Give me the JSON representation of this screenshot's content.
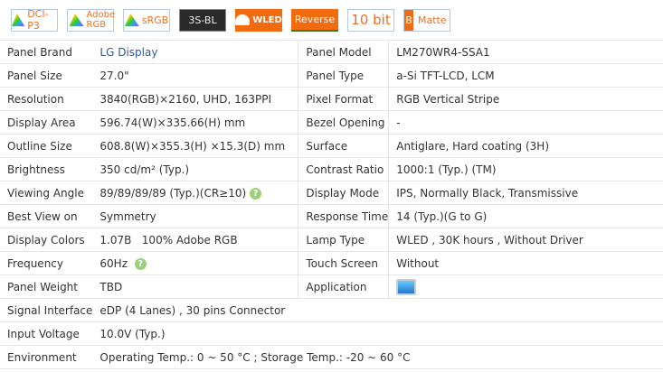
{
  "badges": [
    {
      "label": "DCI-P3",
      "icon": "color-gamut-triangle-icon"
    },
    {
      "label": "Adobe RGB",
      "icon": "color-gamut-triangle-icon"
    },
    {
      "label": "sRGB",
      "icon": "color-gamut-triangle-icon"
    },
    {
      "label": "3S-BL"
    },
    {
      "label": "WLED",
      "icon": "led-icon"
    },
    {
      "label": "Reverse"
    },
    {
      "label": "10 bit"
    },
    {
      "label": "Matte",
      "letter": "B"
    }
  ],
  "specs": {
    "panel_brand": {
      "label": "Panel Brand",
      "value": "LG Display"
    },
    "panel_model": {
      "label": "Panel Model",
      "value": "LM270WR4-SSA1"
    },
    "panel_size": {
      "label": "Panel Size",
      "value": "27.0\""
    },
    "panel_type": {
      "label": "Panel Type",
      "value": "a-Si TFT-LCD, LCM"
    },
    "resolution": {
      "label": "Resolution",
      "value": "3840(RGB)×2160, UHD, 163PPI"
    },
    "pixel_format": {
      "label": "Pixel Format",
      "value": "RGB Vertical Stripe"
    },
    "display_area": {
      "label": "Display Area",
      "value": "596.74(W)×335.66(H) mm"
    },
    "bezel_opening": {
      "label": "Bezel Opening",
      "value": "-"
    },
    "outline_size": {
      "label": "Outline Size",
      "value": "608.8(W)×355.3(H) ×15.3(D) mm"
    },
    "surface": {
      "label": "Surface",
      "value": "Antiglare, Hard coating (3H)"
    },
    "brightness": {
      "label": "Brightness",
      "value": "350 cd/m² (Typ.)"
    },
    "contrast_ratio": {
      "label": "Contrast Ratio",
      "value": "1000:1 (Typ.) (TM)"
    },
    "viewing_angle": {
      "label": "Viewing Angle",
      "value": "89/89/89/89 (Typ.)(CR≥10)"
    },
    "display_mode": {
      "label": "Display Mode",
      "value": "IPS, Normally Black, Transmissive"
    },
    "best_view": {
      "label": "Best View on",
      "value": "Symmetry"
    },
    "response_time": {
      "label": "Response Time",
      "value": "14 (Typ.)(G to G)"
    },
    "display_colors": {
      "label": "Display Colors",
      "value": "1.07B   100% Adobe RGB"
    },
    "lamp_type": {
      "label": "Lamp Type",
      "value": "WLED , 30K hours , Without Driver"
    },
    "frequency": {
      "label": "Frequency",
      "value": "60Hz"
    },
    "touch_screen": {
      "label": "Touch Screen",
      "value": "Without"
    },
    "panel_weight": {
      "label": "Panel Weight",
      "value": "TBD"
    },
    "application": {
      "label": "Application",
      "icon": "monitor-icon"
    },
    "signal_interface": {
      "label": "Signal Interface",
      "value": "eDP (4 Lanes) , 30 pins Connector"
    },
    "input_voltage": {
      "label": "Input Voltage",
      "value": "10.0V (Typ.)"
    },
    "environment": {
      "label": "Environment",
      "value": "Operating Temp.: 0 ~ 50 °C ; Storage Temp.: -20 ~ 60 °C"
    }
  },
  "help_glyph": "?"
}
